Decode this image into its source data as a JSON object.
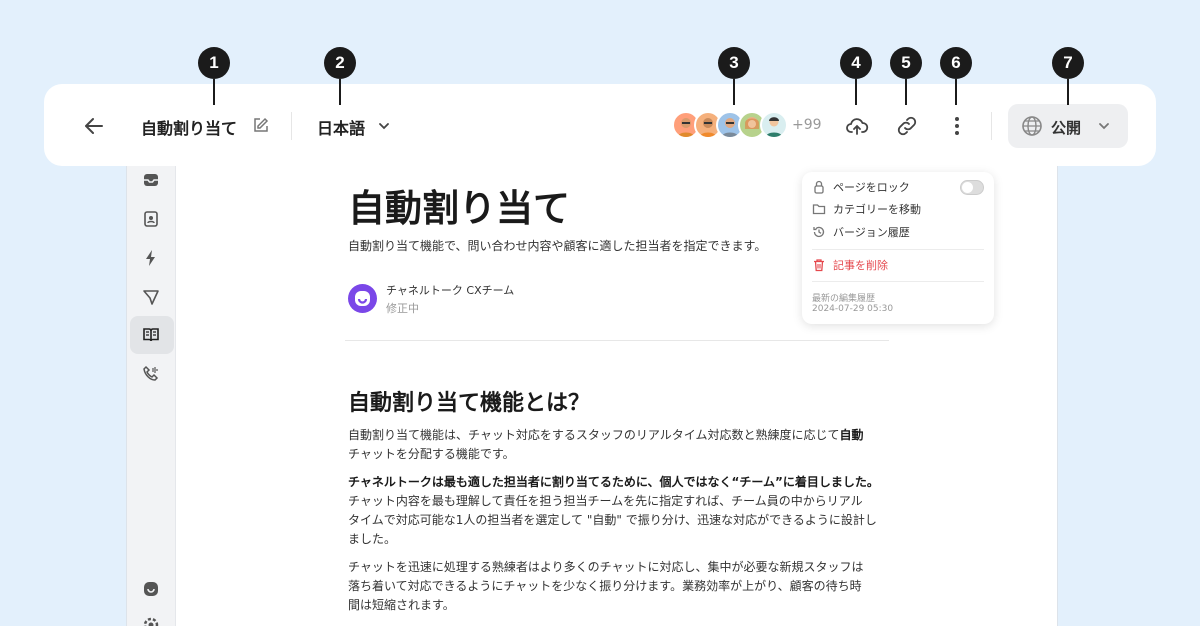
{
  "callouts": [
    "1",
    "2",
    "3",
    "4",
    "5",
    "6",
    "7"
  ],
  "topbar": {
    "title": "自動割り当て",
    "language": "日本語",
    "more_users": "+99",
    "publish_label": "公開",
    "icons": [
      "back-arrow-icon",
      "edit-icon",
      "chevron-down-icon",
      "upload-cloud-icon",
      "link-icon",
      "more-vertical-icon",
      "globe-icon",
      "chevron-down-icon"
    ]
  },
  "menu": {
    "lock_label": "ページをロック",
    "lock_enabled": false,
    "move_label": "カテゴリーを移動",
    "history_label": "バージョン履歴",
    "delete_label": "記事を削除",
    "last_edit_label": "最新の編集履歴",
    "last_edit_time": "2024-07-29 05:30",
    "colors": {
      "delete": "#e5484d"
    }
  },
  "article": {
    "title": "自動割り当て",
    "summary": "自動割り当て機能で、問い合わせ内容や顧客に適した担当者を指定できます。",
    "author": "チャネルトーク CXチーム",
    "status": "修正中",
    "heading": "自動割り当て機能とは？",
    "p1_a": "自動割り当て機能は、チャット対応をするスタッフのリアルタイム対応数と熟練度に応じて",
    "p1_b": "自動",
    "p1_c": "チャットを分配する機能です。",
    "p2_bold": "チャネルトークは最も適した担当者に割り当てるために、個人ではなく“チーム”に着目しました。",
    "p2_a": "チャット内容を最も理解して責任を担う担当チームを先に指定すれば、チーム員の中からリアル",
    "p2_b": "タイムで対応可能な1人の担当者を選定して \"自動\" で振り分け、迅速な対応ができるように設計し",
    "p2_c": "ました。",
    "p3_a": "チャットを迅速に処理する熟練者はより多くのチャットに対応し、集中が必要な新規スタッフは",
    "p3_b": "落ち着いて対応できるようにチャットを少なく振り分けます。業務効率が上がり、顧客の待ち時",
    "p3_c": "間は短縮されます。"
  },
  "sidebar": {
    "icons": [
      "inbox-icon",
      "contacts-icon",
      "bolt-icon",
      "send-icon",
      "book-icon",
      "phone-icon",
      "channel-logo-icon",
      "settings-icon"
    ],
    "active": "book-icon"
  },
  "colors": {
    "background": "#e3f0fc",
    "brand": "#7a47e8",
    "callout": "#1b1b1b"
  }
}
